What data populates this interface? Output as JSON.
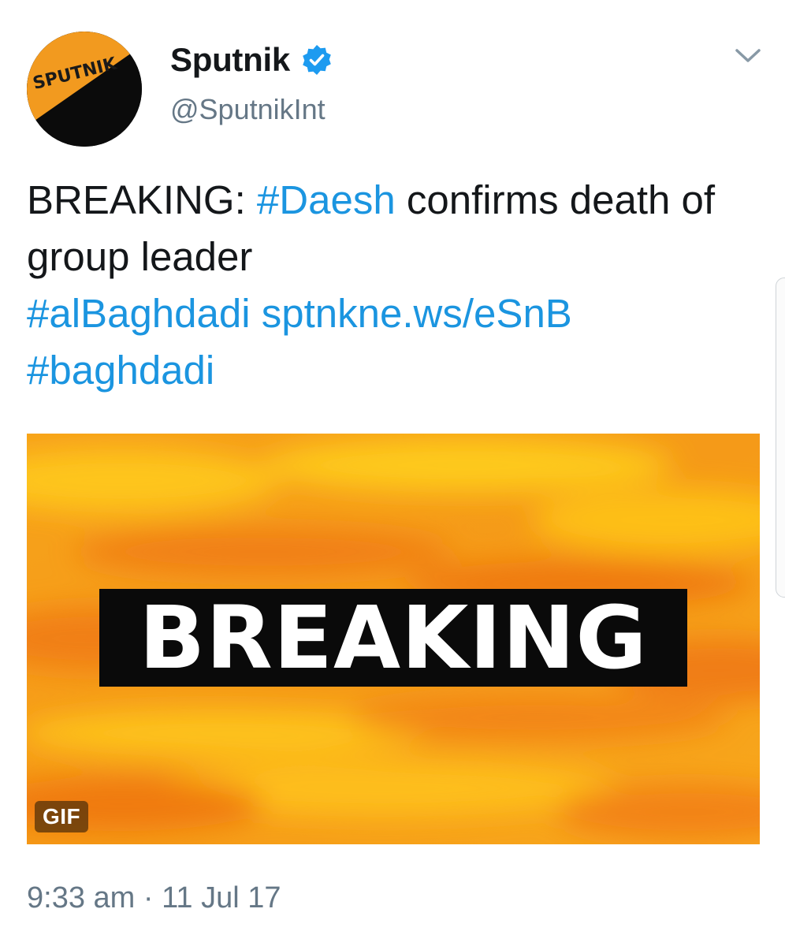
{
  "author": {
    "name": "Sputnik",
    "handle": "@SputnikInt",
    "verified": true,
    "avatar_text": "SPUTNIK"
  },
  "tweet": {
    "text_parts": [
      {
        "text": "BREAKING: ",
        "type": "text"
      },
      {
        "text": "#Daesh",
        "type": "hashtag"
      },
      {
        "text": " confirms death of group leader ",
        "type": "text"
      },
      {
        "text": "#alBaghdadi",
        "type": "hashtag"
      },
      {
        "text": " ",
        "type": "text"
      },
      {
        "text": "sptnkne.ws/eSnB",
        "type": "link"
      },
      {
        "text": " ",
        "type": "text"
      },
      {
        "text": "#baghdadi",
        "type": "hashtag"
      }
    ],
    "media": {
      "banner_text": "BREAKING",
      "badge": "GIF"
    },
    "timestamp": "9:33 am · 11 Jul 17"
  },
  "colors": {
    "link": "#1b95e0",
    "text": "#14171a",
    "muted": "#657786",
    "brand_orange": "#f29a1f"
  },
  "icons": {
    "verified": "verified-badge-icon",
    "menu": "chevron-down-icon"
  }
}
